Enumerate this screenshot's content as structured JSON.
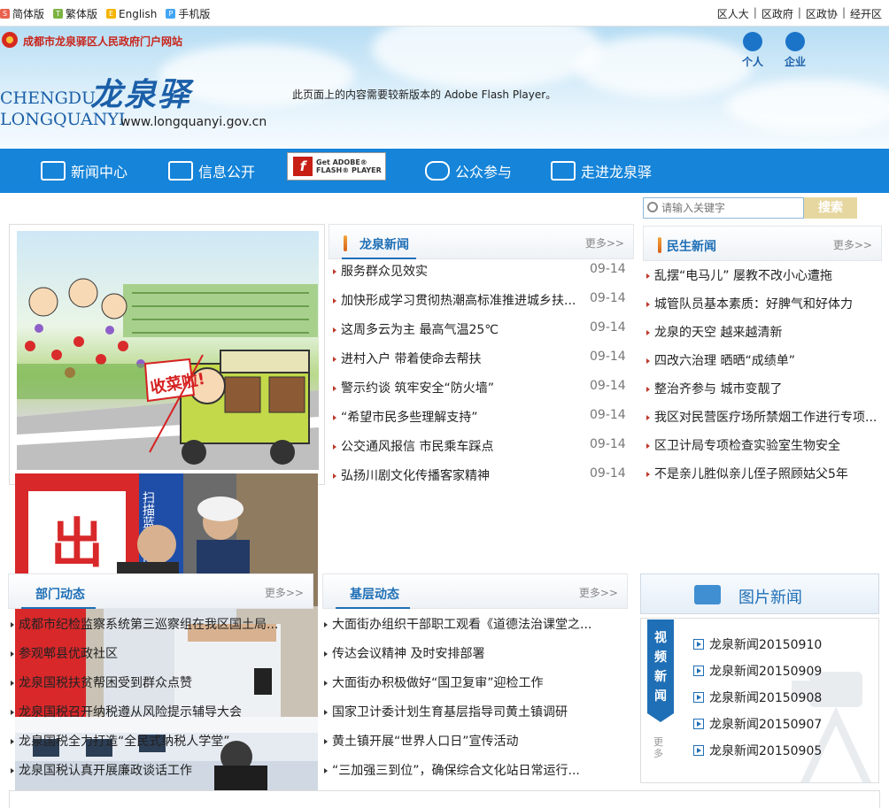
{
  "topbar": {
    "lang": [
      {
        "label": "简体版",
        "icon": "simplified-icon",
        "color": "#e8604c"
      },
      {
        "label": "繁体版",
        "icon": "traditional-icon",
        "color": "#7cb342"
      },
      {
        "label": "English",
        "icon": "english-icon",
        "color": "#f4b400"
      },
      {
        "label": "手机版",
        "icon": "mobile-icon",
        "color": "#42a5f5"
      }
    ],
    "sites": [
      "区人大",
      "区政府",
      "区政协",
      "经开区"
    ],
    "sep": "|"
  },
  "header": {
    "portal": "成都市龙泉驿区人民政府门户网站",
    "chengdu": "CHENGDU",
    "longquanyi": "LONGQUANYI",
    "cn_logo": "龙泉驿",
    "url": "www.longquanyi.gov.cn",
    "flash_message": "此页面上的内容需要较新版本的 Adobe Flash Player。",
    "roles": [
      {
        "label": "个人",
        "icon": "person-icon"
      },
      {
        "label": "企业",
        "icon": "enterprise-icon"
      }
    ]
  },
  "nav": {
    "items": [
      {
        "label": "新闻中心",
        "icon": "news-icon"
      },
      {
        "label": "信息公开",
        "icon": "info-icon"
      },
      {
        "label": "公众参与",
        "icon": "chat-icon"
      },
      {
        "label": "走进龙泉驿",
        "icon": "camera-icon"
      }
    ],
    "flash_badge": {
      "line1": "Get ADOBE®",
      "line2": "FLASH® PLAYER"
    }
  },
  "search": {
    "placeholder": "请输入关键字",
    "button": "搜索"
  },
  "more_label": "更多>>",
  "longquan_news": {
    "title": "龙泉新闻",
    "items": [
      {
        "text": "服务群众见效实",
        "date": "09-14"
      },
      {
        "text": "加快形成学习贯彻热潮高标准推进城乡扶...",
        "date": "09-14"
      },
      {
        "text": "这周多云为主 最高气温25℃",
        "date": "09-14"
      },
      {
        "text": "进村入户 带着使命去帮扶",
        "date": "09-14"
      },
      {
        "text": "警示约谈 筑牢安全“防火墙”",
        "date": "09-14"
      },
      {
        "text": "“希望市民多些理解支持”",
        "date": "09-14"
      },
      {
        "text": "公交通风报信 市民乘车踩点",
        "date": "09-14"
      },
      {
        "text": "弘扬川剧文化传播客家精神",
        "date": "09-14"
      }
    ]
  },
  "livelihood_news": {
    "title": "民生新闻",
    "items": [
      "乱摆“电马儿” 屡教不改小心遭拖",
      "城管队员基本素质：好脾气和好体力",
      "龙泉的天空 越来越清新",
      "四改六治理 晒晒“成绩单”",
      "整治齐参与 城市变靓了",
      "我区对民营医疗场所禁烟工作进行专项...",
      "区卫计局专项检查实验室生物安全",
      "不是亲儿胜似亲儿侄子照顾姑父5年"
    ]
  },
  "dept_news": {
    "title": "部门动态",
    "items": [
      "成都市纪检监察系统第三巡察组在我区国土局...",
      "参观郫县优政社区",
      "龙泉国税扶贫帮困受到群众点赞",
      "龙泉国税召开纳税遵从风险提示辅导大会",
      "龙泉国税全力打造“全民式纳税人学堂”",
      "龙泉国税认真开展廉政谈话工作"
    ]
  },
  "grassroots_news": {
    "title": "基层动态",
    "items": [
      "大面街办组织干部职工观看《道德法治课堂之...",
      "传达会议精神 及时安排部署",
      "大面街办积极做好“国卫复审”迎检工作",
      "国家卫计委计划生育基层指导司黄土镇调研",
      "黄土镇开展“世界人口日”宣传活动",
      "“三加强三到位”，确保综合文化站日常运行..."
    ]
  },
  "picture_news": {
    "title": "图片新闻"
  },
  "video_news": {
    "tab": [
      "视",
      "频",
      "新",
      "闻"
    ],
    "more": [
      "更",
      "多"
    ],
    "items": [
      "龙泉新闻20150910",
      "龙泉新闻20150909",
      "龙泉新闻20150908",
      "龙泉新闻20150907",
      "龙泉新闻20150905"
    ]
  },
  "cartoon": {
    "banner": "收菜啦!"
  },
  "photo_signs": {
    "sign1": "出",
    "sign2": "扫描蓝图彩印"
  }
}
